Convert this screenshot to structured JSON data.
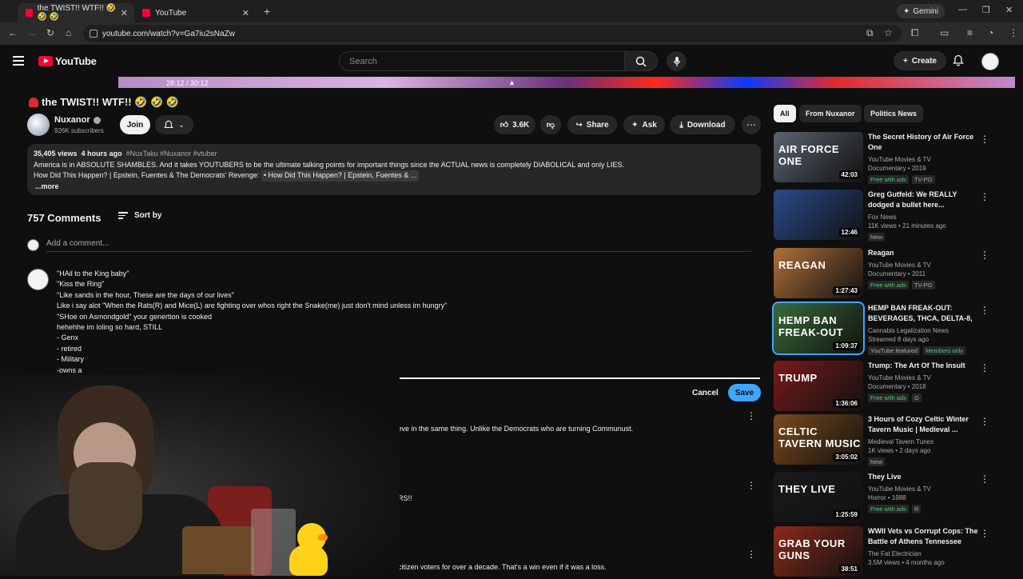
{
  "browser": {
    "tabs": [
      {
        "label": "the TWIST!! WTF!! 🤣 🤣 🤣",
        "active": true
      },
      {
        "label": "YouTube",
        "active": false
      }
    ],
    "gemini_label": "Gemini",
    "url": "youtube.com/watch?v=Ga7iu2sNaZw"
  },
  "header": {
    "logo": "YouTube",
    "search_placeholder": "Search",
    "create_label": "Create"
  },
  "player": {
    "time": "28:12 / 30:12"
  },
  "video": {
    "title": "the TWIST!! WTF!! 🤣 🤣 🤣",
    "channel": "Nuxanor",
    "subscribers": "926K subscribers",
    "join_label": "Join",
    "likes": "3.6K",
    "share_label": "Share",
    "ask_label": "Ask",
    "download_label": "Download",
    "views": "35,405 views",
    "age": "4 hours ago",
    "tags": "#NuxTaku #Nuxanor #vtuber",
    "desc_line1": "America is in ABSOLUTE SHAMBLES. And it takes YOUTUBERS to be the ultimate talking points for important things since the ACTUAL news is completely DIABOLICAL and only LIES.",
    "desc_line2": "How Did This Happen? | Epstein, Fuentes & The Democrats' Revenge:",
    "desc_chip": "• How Did This Happen? | Epstein, Fuentes & ...",
    "more_label": "...more"
  },
  "comments": {
    "count": "757 Comments",
    "sort_label": "Sort by",
    "add_placeholder": "Add a comment...",
    "edit_lines": [
      "\"HAil to the King baby\"",
      "\"Kiss the Ring\"",
      "\"Like sands in the hour, These are the days of our lives\"",
      "Like i say alot \"When the Rats(R) and Mice(L) are fighting over whos right the Snake(me) just don't mind unless im hungry\"",
      "\"SHoe on Asmondgold\" your genertion is cooked",
      "hehehhe im loling so hard, STILL",
      "- Genx",
      "- retired",
      "- Military",
      "-owns a"
    ],
    "cancel_label": "Cancel",
    "save_label": "Save",
    "partial": [
      "ar    e, doesn't mean they still don't believe in the same thing. Unlike the Democrats who are turning Communust.",
      "OSE NUMBERS!!",
      "n-citizen voters for over a decade. That's a win even if it was a loss."
    ]
  },
  "sidebar": {
    "chips": [
      "All",
      "From Nuxanor",
      "Politics News"
    ],
    "recs": [
      {
        "thumb": "AIR FORCE ONE",
        "duration": "42:03",
        "title": "The Secret History of Air Force One",
        "channel": "YouTube Movies & TV",
        "meta": "Documentary • 2019",
        "badges": [
          "Free with ads",
          "TV-PG"
        ],
        "color": "#5a6470"
      },
      {
        "thumb": "",
        "duration": "12:46",
        "title": "Greg Gutfeld: We REALLY dodged a bullet here...",
        "channel": "Fox News",
        "meta": "11K views • 21 minutes ago",
        "badges": [
          "New"
        ],
        "color": "#2a4a8a"
      },
      {
        "thumb": "REAGAN",
        "duration": "1:27:43",
        "title": "Reagan",
        "channel": "YouTube Movies & TV",
        "meta": "Documentary • 2011",
        "badges": [
          "Free with ads",
          "TV-PG"
        ],
        "color": "#b0703a"
      },
      {
        "thumb": "HEMP BAN FREAK-OUT",
        "duration": "1:09:37",
        "title": "HEMP BAN FREAK-OUT: BEVERAGES, THCA, DELTA-8, ...",
        "channel": "Cannabis Legalization News",
        "meta": "Streamed 8 days ago",
        "badges": [
          "YouTube featured",
          "Members only"
        ],
        "color": "#3a6a3a"
      },
      {
        "thumb": "TRUMP",
        "duration": "1:36:06",
        "title": "Trump: The Art Of The Insult",
        "channel": "YouTube Movies & TV",
        "meta": "Documentary • 2018",
        "badges": [
          "Free with ads",
          "G"
        ],
        "color": "#7a1a1a"
      },
      {
        "thumb": "CELTIC TAVERN MUSIC",
        "duration": "3:05:02",
        "title": "3 Hours of Cozy Celtic Winter Tavern Music | Medieval ...",
        "channel": "Medieval Tavern Tunes",
        "meta": "1K views • 2 days ago",
        "badges": [
          "New"
        ],
        "color": "#7a4a1a"
      },
      {
        "thumb": "THEY LIVE",
        "duration": "1:25:59",
        "title": "They Live",
        "channel": "YouTube Movies & TV",
        "meta": "Horror • 1988",
        "badges": [
          "Free with ads",
          "R"
        ],
        "color": "#1a1a1a"
      },
      {
        "thumb": "GRAB YOUR GUNS",
        "duration": "38:51",
        "title": "WWII Vets vs Corrupt Cops: The Battle of Athens Tennessee",
        "channel": "The Fat Electrician",
        "meta": "3.5M views • 4 months ago",
        "badges": [],
        "color": "#8a2a1a"
      }
    ]
  }
}
